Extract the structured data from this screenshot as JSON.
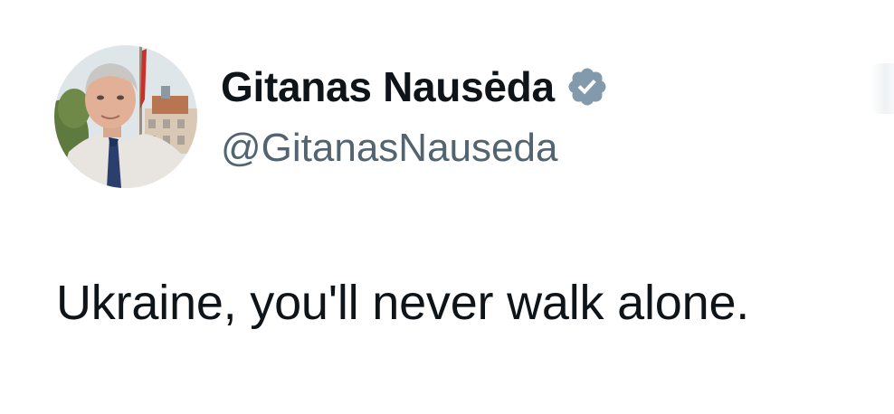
{
  "author": {
    "display_name": "Gitanas Nausėda",
    "handle": "@GitanasNauseda",
    "verified": true,
    "avatar_icon": "profile-photo"
  },
  "tweet": {
    "text": "Ukraine, you'll never walk alone."
  },
  "colors": {
    "primary_text": "#0f1419",
    "secondary_text": "#536471",
    "verified_badge": "#829aab",
    "background": "#ffffff"
  }
}
